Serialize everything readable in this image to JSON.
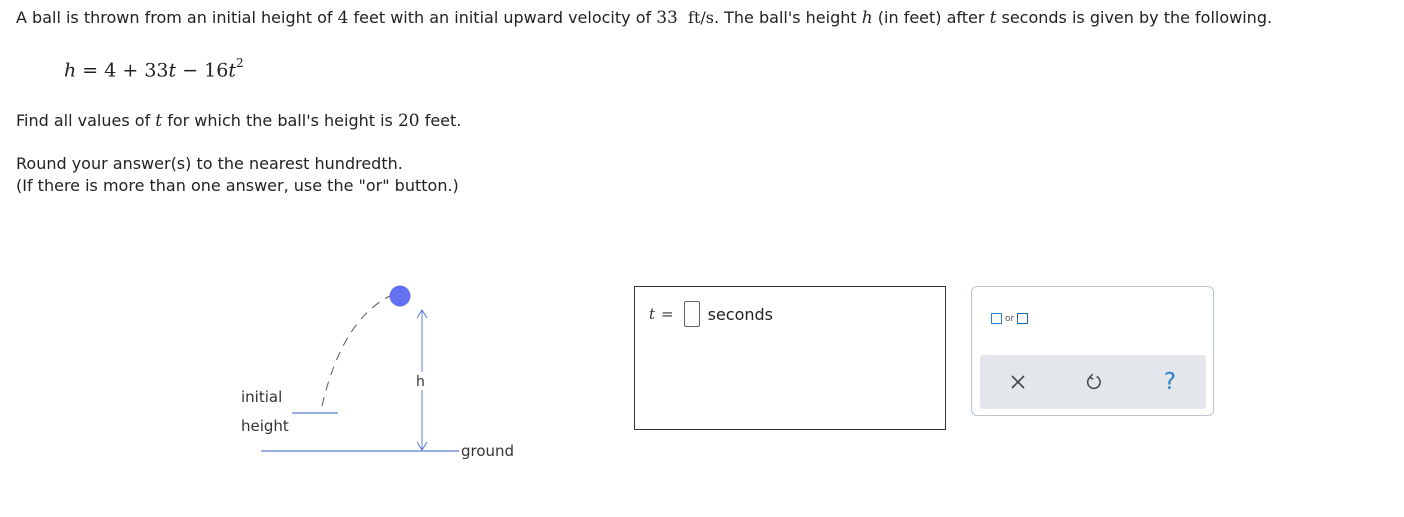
{
  "problem": {
    "p1": "A ball is thrown from an initial height of ",
    "height_value": "4",
    "p2": " feet with an initial upward velocity of ",
    "velocity_value": "33",
    "velocity_unit": "ft/s",
    "p3": ". The ball's height ",
    "h_var": "h",
    "p4": " (in feet) after ",
    "t_var": "t",
    "p5": " seconds is given by the following."
  },
  "equation": {
    "lhs": "h",
    "rhs_const": "4",
    "rhs_coef1": "33",
    "var1": "t",
    "rhs_coef2": "16",
    "var2": "t",
    "exponent": "2"
  },
  "question": {
    "q1": "Find all values of ",
    "t_var": "t",
    "q2": " for which the ball's height is ",
    "target_value": "20",
    "q3": " feet."
  },
  "instructions": {
    "round": "Round your answer(s) to the nearest hundredth.",
    "or_hint": "(If there is more than one answer, use the \"or\" button.)"
  },
  "figure": {
    "label_initial": "initial",
    "label_height": "height",
    "label_h": "h",
    "label_ground": "ground"
  },
  "answer": {
    "var": "t",
    "equals": "=",
    "value": "",
    "unit": "seconds"
  },
  "tools": {
    "or_label": "or",
    "clear_icon": "x-icon",
    "undo_icon": "undo-icon",
    "help_icon": "help-icon",
    "help_glyph": "?"
  },
  "colors": {
    "ball": "#6671f2",
    "arrow": "#5b7fd6",
    "accent": "#2d7fc8",
    "panel_gray": "#e3e6ea"
  }
}
